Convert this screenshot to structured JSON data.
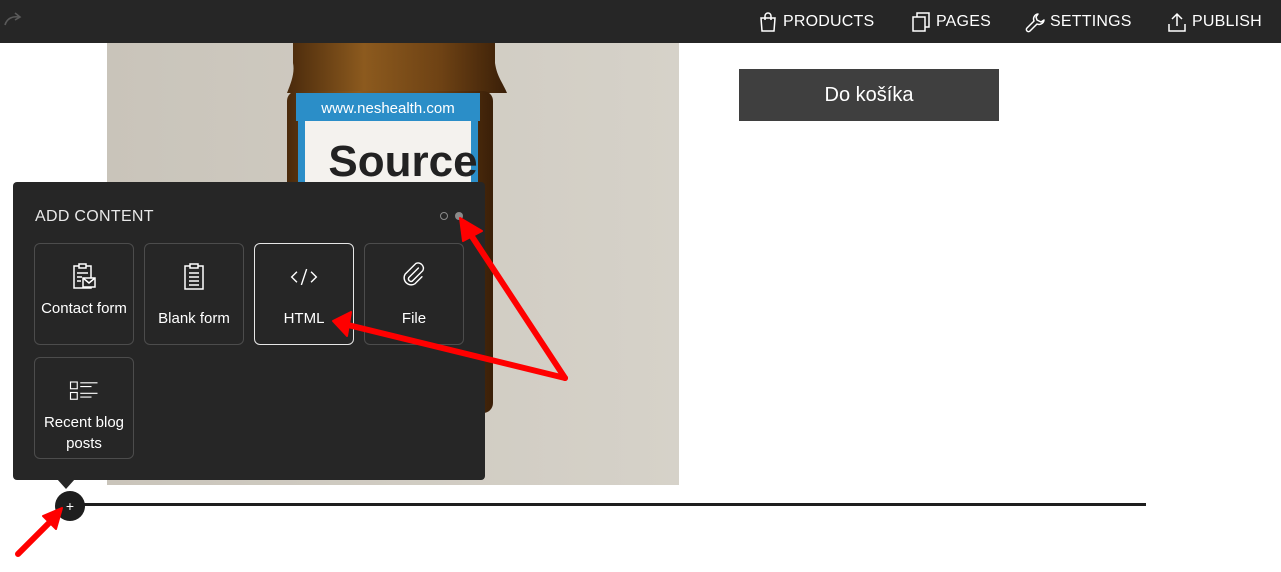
{
  "topbar": {
    "items": [
      {
        "label": "PRODUCTS",
        "icon": "shopping-bag-icon"
      },
      {
        "label": "PAGES",
        "icon": "pages-icon"
      },
      {
        "label": "SETTINGS",
        "icon": "wrench-icon"
      },
      {
        "label": "PUBLISH",
        "icon": "upload-icon"
      }
    ],
    "redo_icon": "redo-arrow-icon"
  },
  "product": {
    "image": {
      "url_text": "www.neshealth.com",
      "brand_text": "Source",
      "icon": "product-bottle-photo"
    },
    "cart_button": "Do košíka"
  },
  "add_content": {
    "title": "ADD CONTENT",
    "current_page": 2,
    "page_count": 2,
    "tiles": [
      {
        "label": "Contact form",
        "icon": "contact-form-icon"
      },
      {
        "label": "Blank form",
        "icon": "blank-form-icon"
      },
      {
        "label": "HTML",
        "icon": "code-icon"
      },
      {
        "label": "File",
        "icon": "paperclip-icon"
      },
      {
        "label": "Recent blog posts",
        "icon": "blog-list-icon"
      }
    ]
  },
  "add_button": "+",
  "colors": {
    "topbar": "#262626",
    "panel": "#262626",
    "cart_button": "#3f3f3f",
    "annotation_arrow": "#ff0000"
  }
}
